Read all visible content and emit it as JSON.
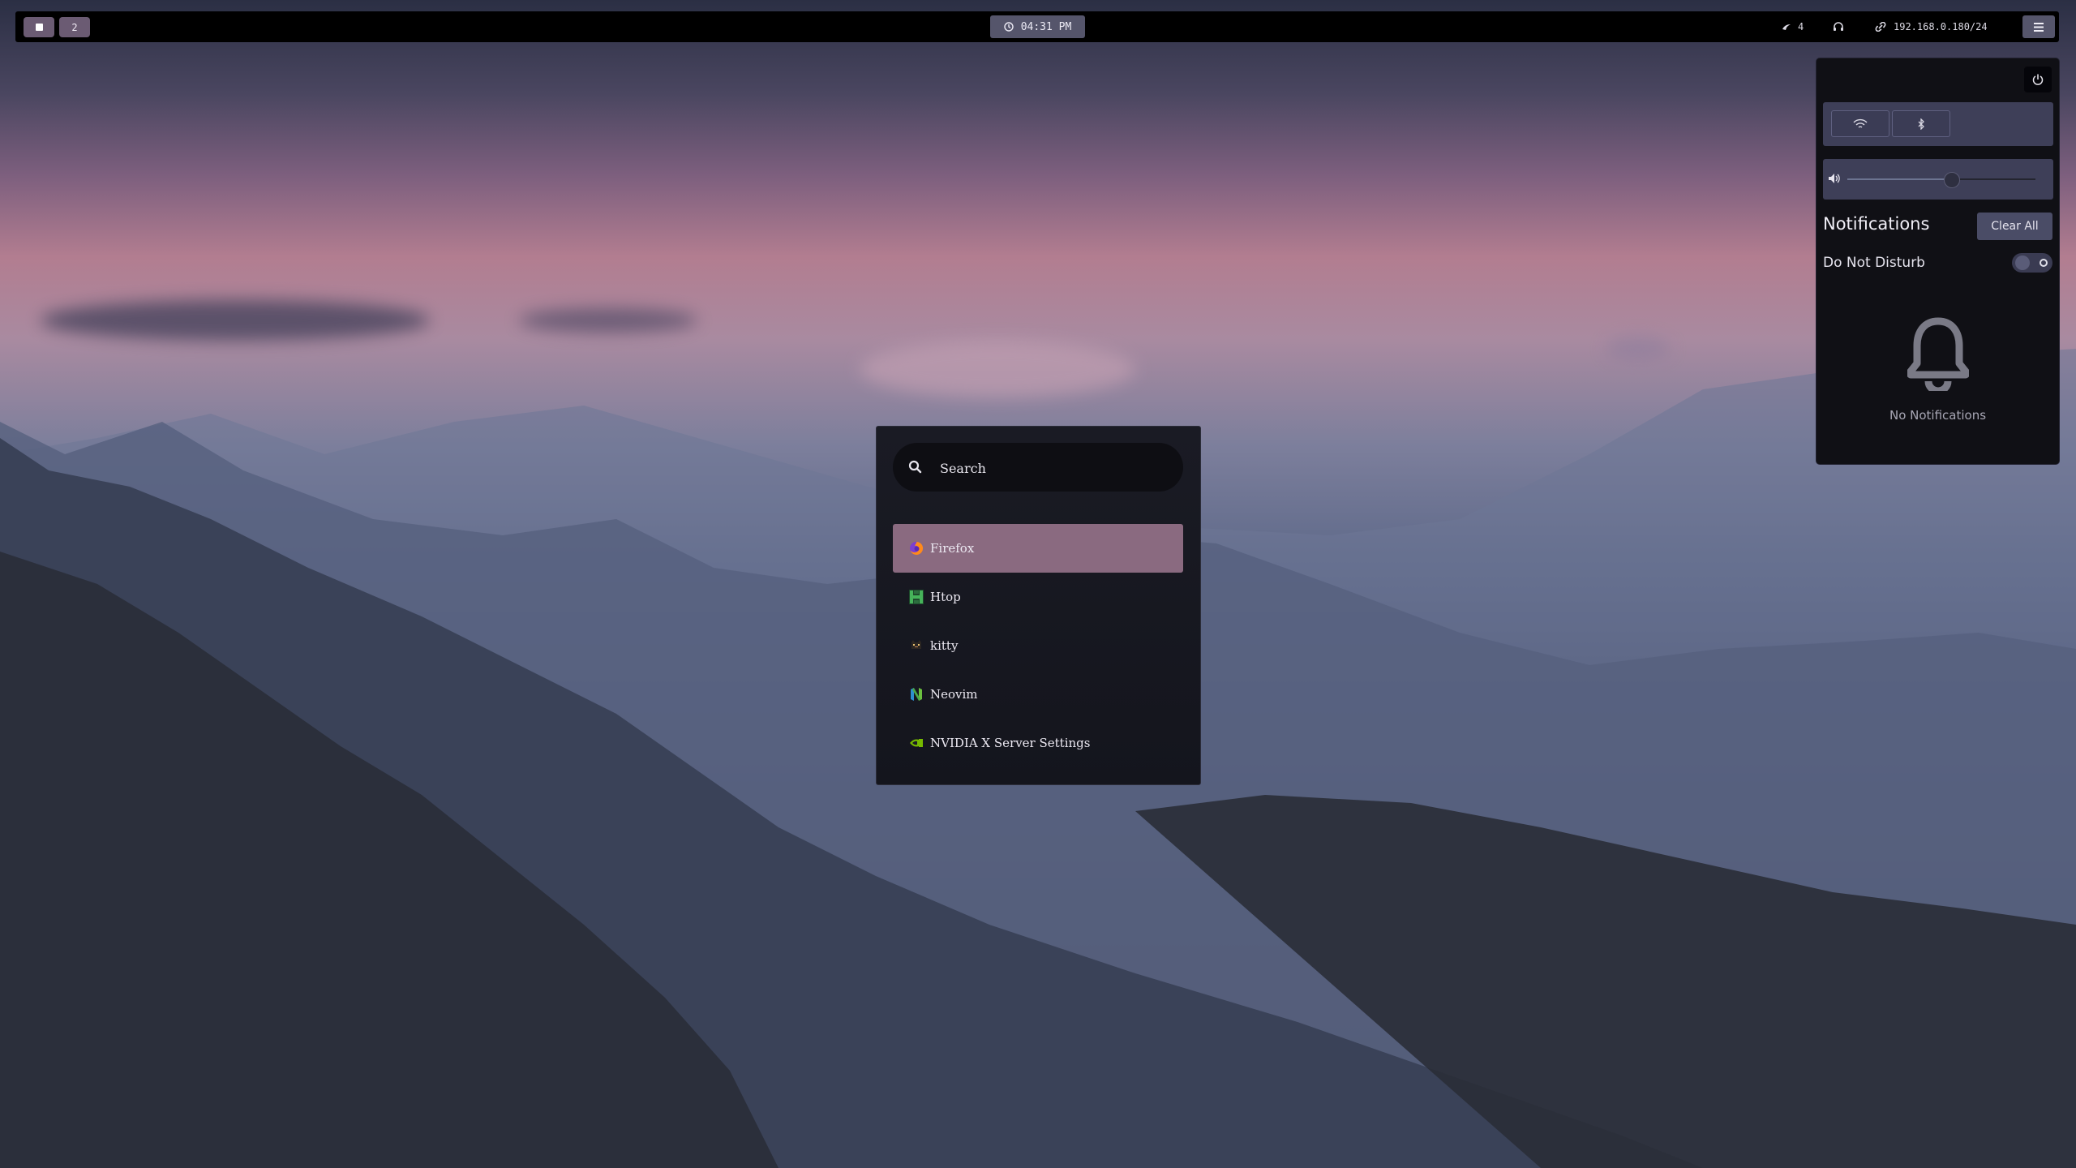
{
  "topbar": {
    "workspaces": [
      {
        "label": "",
        "active": true
      },
      {
        "label": "2",
        "active": false
      }
    ],
    "clock": "04:31 PM",
    "brightness_value": "4",
    "network_address": "192.168.0.180/24"
  },
  "control_panel": {
    "volume_level_percent": 55,
    "notifications_title": "Notifications",
    "clear_all_label": "Clear All",
    "dnd_label": "Do Not Disturb",
    "dnd_enabled": false,
    "empty_text": "No Notifications"
  },
  "launcher": {
    "search_placeholder": "Search",
    "apps": [
      {
        "name": "Firefox",
        "icon": "firefox-icon",
        "selected": true
      },
      {
        "name": "Htop",
        "icon": "htop-icon",
        "selected": false
      },
      {
        "name": "kitty",
        "icon": "kitty-icon",
        "selected": false
      },
      {
        "name": "Neovim",
        "icon": "neovim-icon",
        "selected": false
      },
      {
        "name": "NVIDIA X Server Settings",
        "icon": "nvidia-icon",
        "selected": false
      }
    ]
  },
  "colors": {
    "selected_app": "#8a6a80",
    "bar_button": "#55556b",
    "workspace_button": "#6b5b73"
  }
}
